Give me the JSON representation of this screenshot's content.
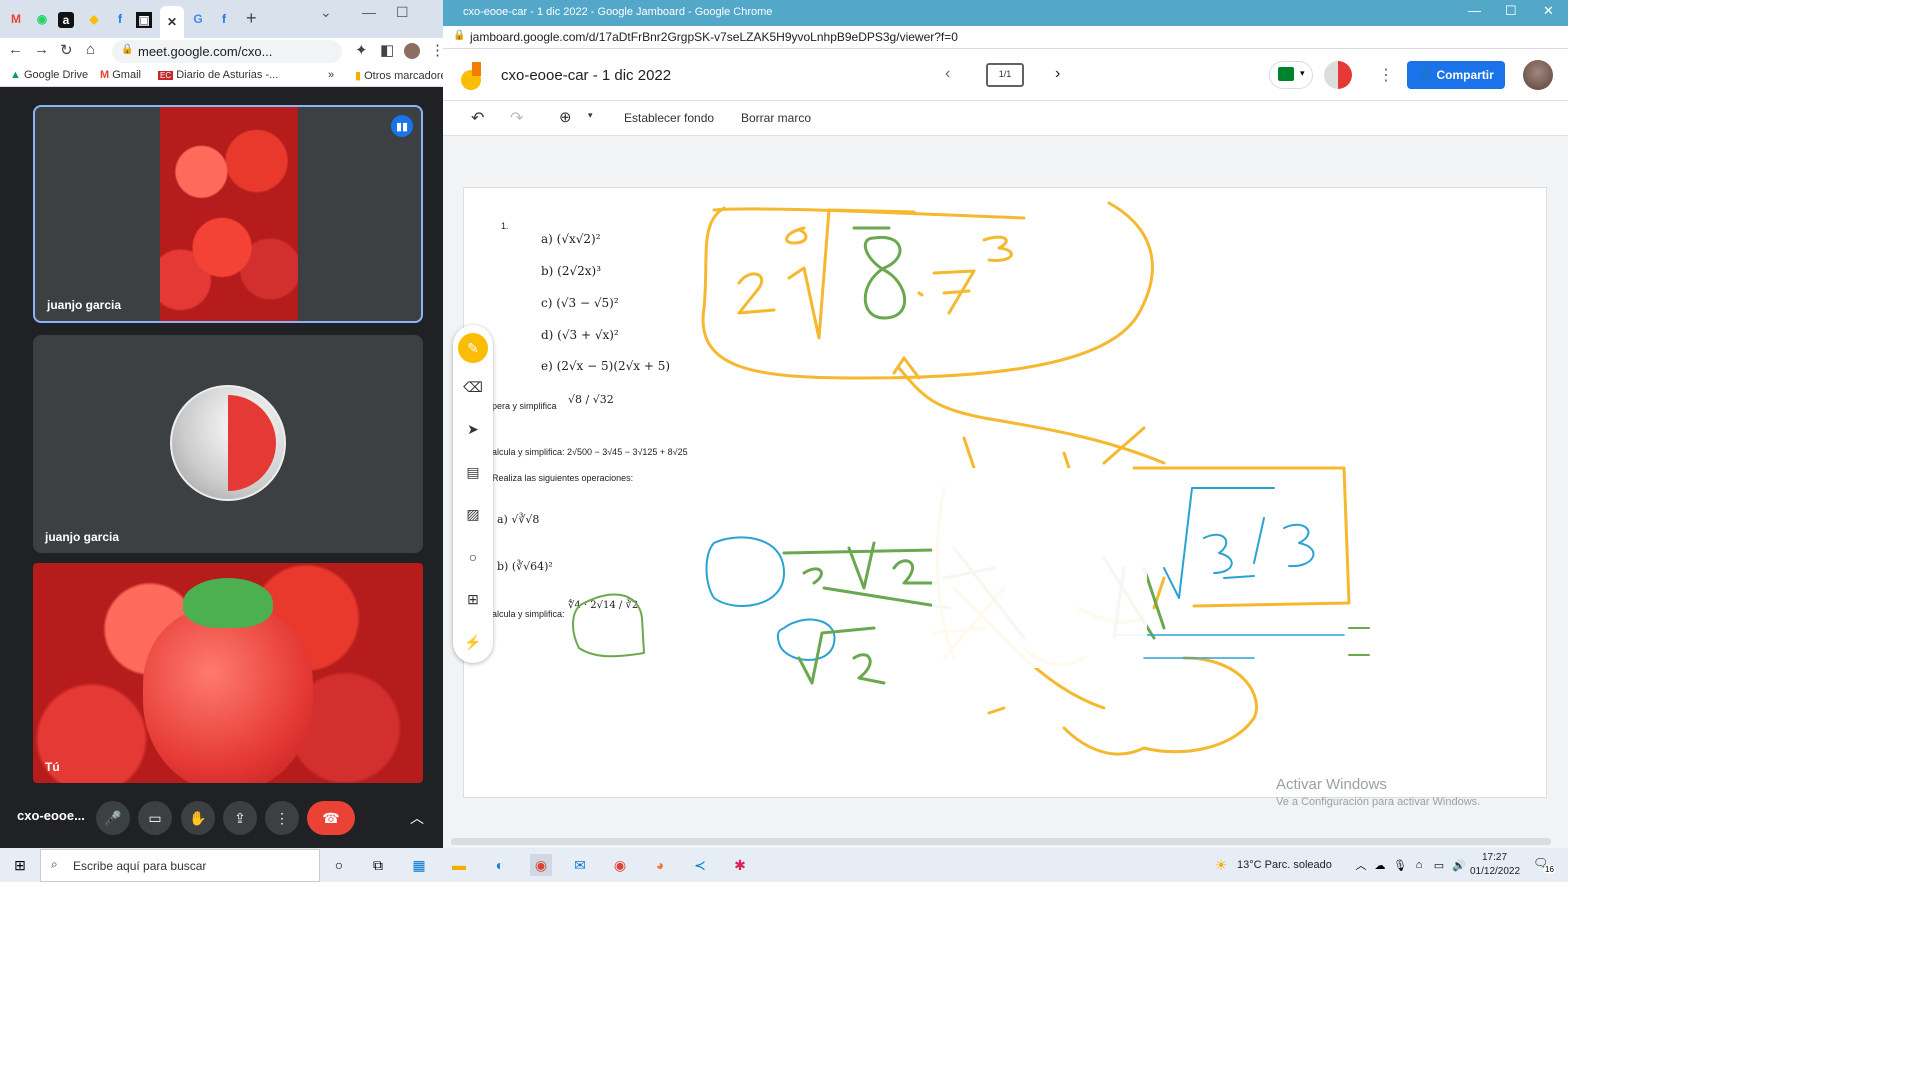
{
  "meet_tab": {
    "address": "meet.google.com/cxo...",
    "bookmarks": [
      "Google Drive",
      "Gmail",
      "Diario de Asturias -...",
      "Otros marcadores"
    ],
    "bm_more": "»"
  },
  "meet": {
    "tile1_name": "juanjo garcia",
    "tile2_name": "juanjo garcia",
    "tile3_name": "Tú",
    "meeting_code": "cxo-eooe...",
    "new_tab": "+"
  },
  "jam_window": {
    "title": "cxo-eooe-car - 1 dic 2022 - Google Jamboard - Google Chrome",
    "address": "jamboard.google.com/d/17aDtFrBnr2GrgpSK-v7seLZAK5H9yvoLnhpB9eDPS3g/viewer?f=0"
  },
  "jamboard": {
    "doc_title": "cxo-eooe-car - 1 dic 2022",
    "frame_counter": "1/1",
    "share_label": "Compartir",
    "set_background": "Establecer fondo",
    "clear_frame": "Borrar marco"
  },
  "worksheet": {
    "number": "1.",
    "items": [
      "a) (√x√2)²",
      "b) (2√2x)³",
      "c) (√3 − √5)²",
      "d) (√3 + √x)²",
      "e) (2√x − 5)(2√x + 5)"
    ],
    "q2_label": "pera y simplifica",
    "q2_frac": "√8 / √32",
    "q3": "alcula y simplifica: 2√500 − 3√45 − 3√125 + 8√25",
    "q4": "Realiza las siguientes operaciones:",
    "q4a": "a) √∛√8",
    "q4b": "b) (∛√64)²",
    "q5_label": "alcula y simplifica:",
    "q5_expr": "∜4 · 2√14 / ∛2"
  },
  "activate": {
    "line1": "Activar Windows",
    "line2": "Ve a Configuración para activar Windows."
  },
  "taskbar": {
    "search_placeholder": "Escribe aquí para buscar",
    "weather": "13°C  Parc. soleado",
    "time": "17:27",
    "date": "01/12/2022",
    "notif": "16"
  }
}
